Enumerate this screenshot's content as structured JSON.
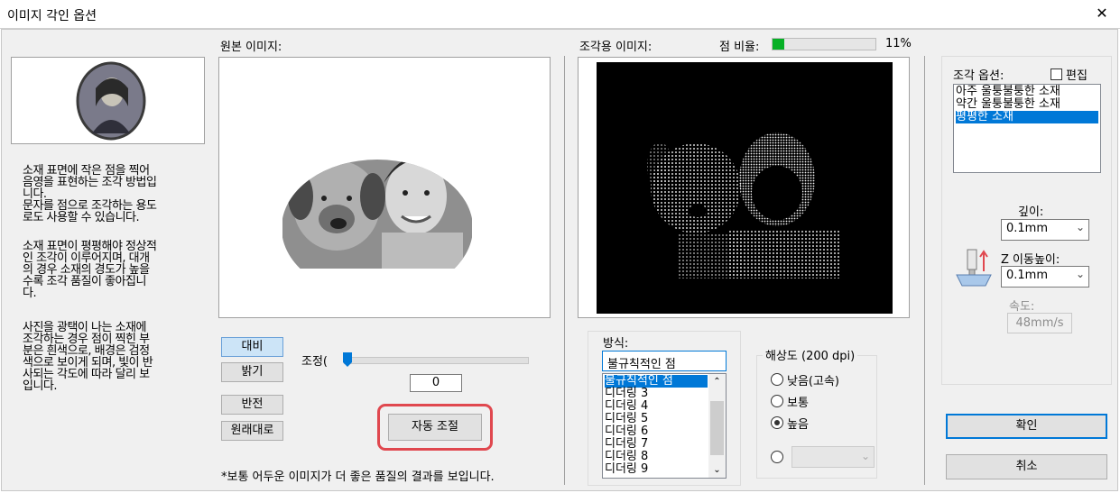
{
  "window": {
    "title": "이미지 각인 옵션",
    "close_glyph": "✕"
  },
  "description": {
    "p1": [
      "소재 표면에 작은 점을 찍어",
      "음영을 표현하는 조각 방법입",
      "니다.",
      "문자를 점으로 조각하는 용도",
      "로도 사용할 수 있습니다."
    ],
    "p2": [
      "소재 표면이 평평해야 정상적",
      "인 조각이 이루어지며, 대개",
      "의 경우 소재의 경도가 높을",
      "수록 조각 품질이 좋아집니",
      "다."
    ],
    "p3": [
      "사진을 광택이 나는 소재에",
      "조각하는 경우 점이 찍힌 부",
      "분은 흰색으로, 배경은 검정",
      "색으로 보이게 되며, 빛이 반",
      "사되는 각도에 따라 달리 보",
      "입니다."
    ]
  },
  "source": {
    "label": "원본 이미지:"
  },
  "engrave": {
    "label": "조각용 이미지:",
    "dot_ratio_label": "점 비율:",
    "dot_ratio_percent": 11,
    "dot_ratio_text": "11%"
  },
  "adjust": {
    "contrast": "대비",
    "brightness": "밝기",
    "invert": "반전",
    "restore": "원래대로",
    "slider_label": "조정(",
    "value": "0",
    "auto": "자동 조절",
    "note": "*보통 어두운 이미지가 더 좋은 품질의 결과를 보입니다."
  },
  "method": {
    "label": "방식:",
    "selected": "불규칙적인 점",
    "options": [
      "불규칙적인 점",
      "디더링 3",
      "디더링 4",
      "디더링 5",
      "디더링 6",
      "디더링 7",
      "디더링 8",
      "디더링 9"
    ]
  },
  "resolution": {
    "title": "해상도 (200 dpi)",
    "options": [
      "낮음(고속)",
      "보통",
      "높음"
    ],
    "selected_index": 2
  },
  "engrave_options": {
    "label": "조각 옵션:",
    "edit_label": "편집",
    "items": [
      "아주 울퉁불퉁한 소재",
      "약간 울퉁불퉁한 소재",
      "평평한 소재"
    ],
    "selected_index": 2,
    "depth_label": "깊이:",
    "depth_value": "0.1mm",
    "z_label": "Z 이동높이:",
    "z_value": "0.1mm",
    "speed_label": "속도:",
    "speed_value": "48mm/s"
  },
  "buttons": {
    "ok": "확인",
    "cancel": "취소"
  },
  "colors": {
    "accent_blue": "#0078d7",
    "progress_green": "#06b025",
    "highlight_red": "#e0484f"
  }
}
